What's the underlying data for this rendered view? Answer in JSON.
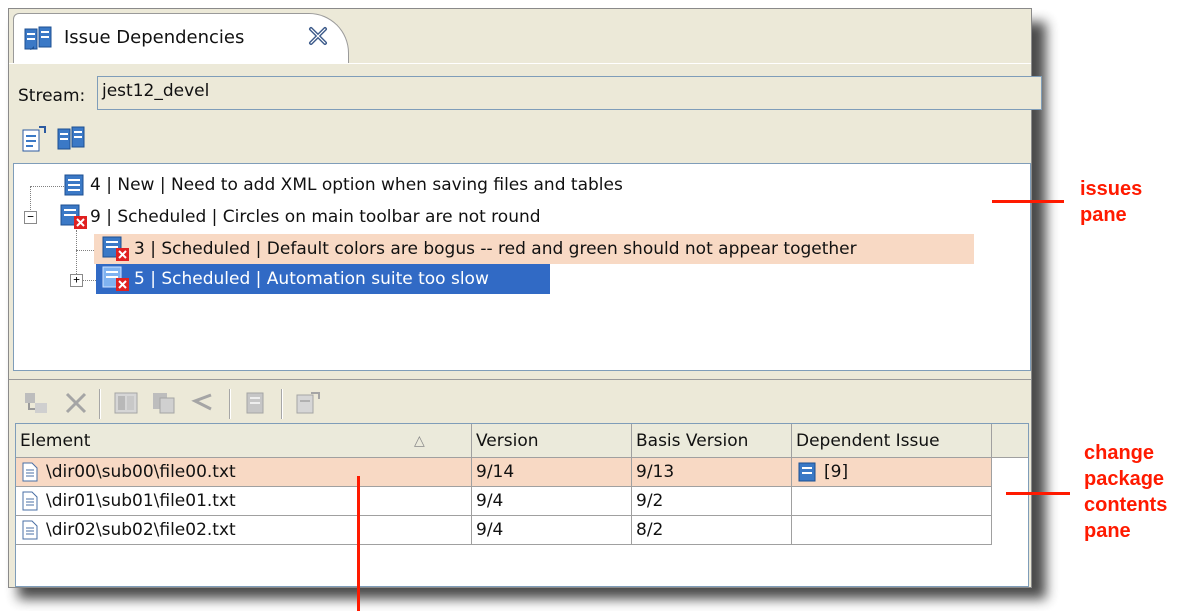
{
  "tab": {
    "title": "Issue Dependencies"
  },
  "stream": {
    "label": "Stream:",
    "value": "jest12_devel"
  },
  "issues": [
    {
      "text": "4 | New | Need to add XML option when saving files and tables",
      "state": "normal"
    },
    {
      "text": "9 | Scheduled | Circles on main toolbar are not round",
      "state": "normal"
    },
    {
      "text": "3 | Scheduled | Default colors are bogus -- red and green should not appear together",
      "state": "highlighted"
    },
    {
      "text": "5 | Scheduled | Automation suite too slow",
      "state": "selected"
    }
  ],
  "table": {
    "columns": [
      "Element",
      "Version",
      "Basis Version",
      "Dependent Issue"
    ],
    "sort_indicator": "△",
    "rows": [
      {
        "element": "\\dir00\\sub00\\file00.txt",
        "version": "9/14",
        "basis": "9/13",
        "dependent": "[9]",
        "state": "highlighted"
      },
      {
        "element": "\\dir01\\sub01\\file01.txt",
        "version": "9/4",
        "basis": "9/2",
        "dependent": "",
        "state": "normal"
      },
      {
        "element": "\\dir02\\sub02\\file02.txt",
        "version": "9/4",
        "basis": "8/2",
        "dependent": "",
        "state": "normal"
      }
    ]
  },
  "annotations": {
    "issues_pane": [
      "issues",
      "pane"
    ],
    "contents_pane": [
      "change",
      "package",
      "contents",
      "pane"
    ]
  },
  "colors": {
    "highlight_row": "#f8d9c4",
    "selection": "#316ac5",
    "annotation": "#ff1a00",
    "chrome": "#ece9d8",
    "issue_icon": "#3b79c6",
    "badge_red": "#e02020"
  },
  "icons": {
    "tab": "issue-dependencies-icon",
    "close": "close-icon",
    "toolbar1": [
      "issue-details-icon",
      "issue-dependencies-icon"
    ],
    "toolbar2": [
      "history-icon",
      "remove-icon",
      "diff-icon",
      "copy-icon",
      "revert-icon",
      "open-icon",
      "properties-icon"
    ],
    "file": "file-icon"
  }
}
